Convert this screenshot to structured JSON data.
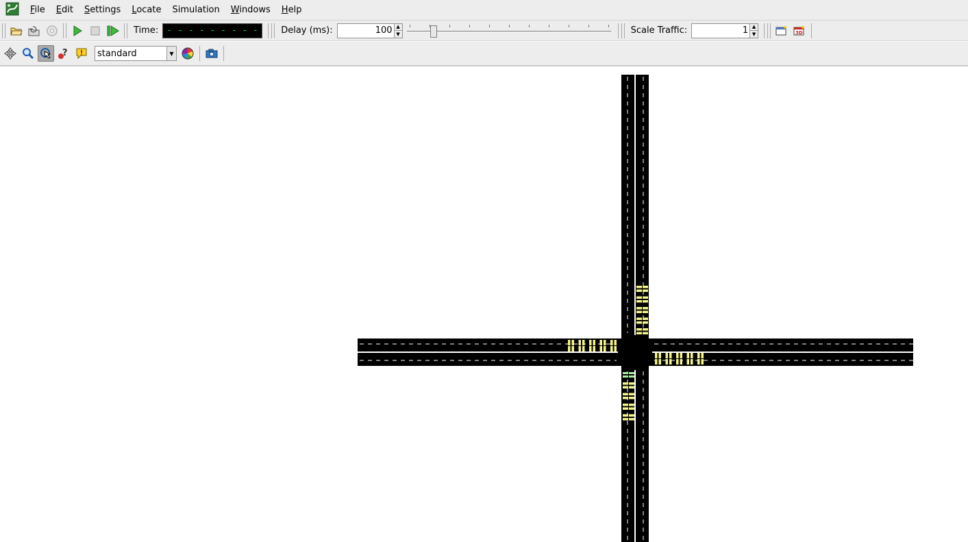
{
  "menu": {
    "items": [
      {
        "mnemonic": "F",
        "rest": "ile"
      },
      {
        "mnemonic": "E",
        "rest": "dit"
      },
      {
        "mnemonic": "S",
        "rest": "ettings"
      },
      {
        "mnemonic": "L",
        "rest": "ocate"
      },
      {
        "mnemonic": "",
        "rest": "Simulation"
      },
      {
        "mnemonic": "W",
        "rest": "indows"
      },
      {
        "mnemonic": "H",
        "rest": "elp"
      }
    ]
  },
  "toolbar": {
    "time_label": "Time:",
    "time_value": "- - - - - - - - - - - - - - - -",
    "delay_label": "Delay (ms):",
    "delay_value": "100",
    "delay_slider_fraction": 0.12,
    "scale_label": "Scale Traffic:",
    "scale_value": "1"
  },
  "view_toolbar": {
    "scheme_value": "standard"
  },
  "colors": {
    "road": "#000000",
    "lane_marking": "#ffffff",
    "vehicle_yellow": "#f5f58a",
    "vehicle_green": "#a8f0a0",
    "time_digits": "#21d04a",
    "toolbar_bg": "#ededed"
  }
}
